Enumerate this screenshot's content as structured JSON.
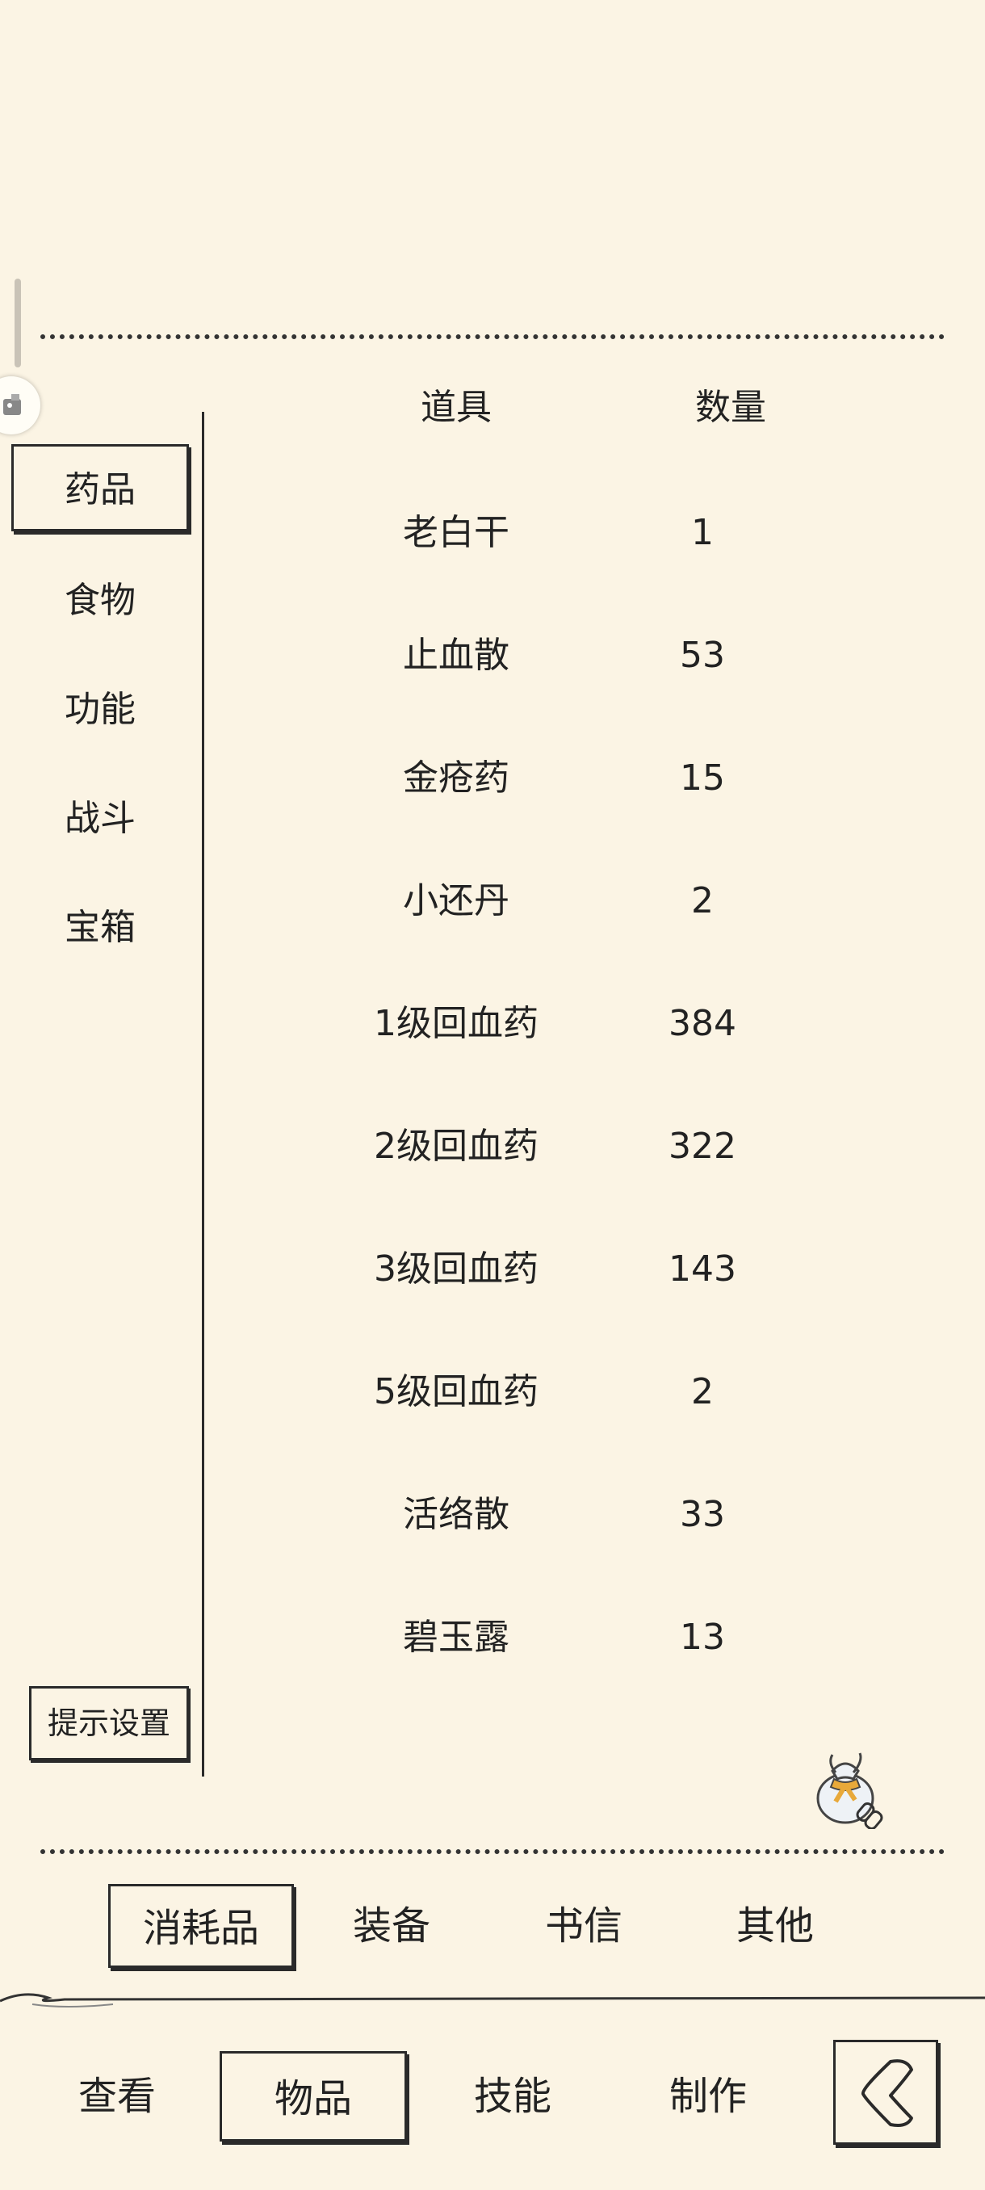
{
  "header": {
    "col_item": "道具",
    "col_qty": "数量"
  },
  "categories": [
    {
      "label": "药品",
      "selected": true
    },
    {
      "label": "食物",
      "selected": false
    },
    {
      "label": "功能",
      "selected": false
    },
    {
      "label": "战斗",
      "selected": false
    },
    {
      "label": "宝箱",
      "selected": false
    }
  ],
  "items": [
    {
      "name": "老白干",
      "qty": "1"
    },
    {
      "name": "止血散",
      "qty": "53"
    },
    {
      "name": "金疮药",
      "qty": "15"
    },
    {
      "name": "小还丹",
      "qty": "2"
    },
    {
      "name": "1级回血药",
      "qty": "384"
    },
    {
      "name": "2级回血药",
      "qty": "322"
    },
    {
      "name": "3级回血药",
      "qty": "143"
    },
    {
      "name": "5级回血药",
      "qty": "2"
    },
    {
      "name": "活络散",
      "qty": "33"
    },
    {
      "name": "碧玉露",
      "qty": "13"
    }
  ],
  "tips_button": "提示设置",
  "sub_tabs": [
    {
      "label": "消耗品",
      "selected": true
    },
    {
      "label": "装备",
      "selected": false
    },
    {
      "label": "书信",
      "selected": false
    },
    {
      "label": "其他",
      "selected": false
    }
  ],
  "nav_tabs": [
    {
      "label": "查看",
      "selected": false
    },
    {
      "label": "物品",
      "selected": true
    },
    {
      "label": "技能",
      "selected": false
    },
    {
      "label": "制作",
      "selected": false
    }
  ],
  "icons": {
    "bag": "cloth-bag-icon",
    "back": "back-arrow-icon",
    "float": "floating-assistant-icon"
  }
}
